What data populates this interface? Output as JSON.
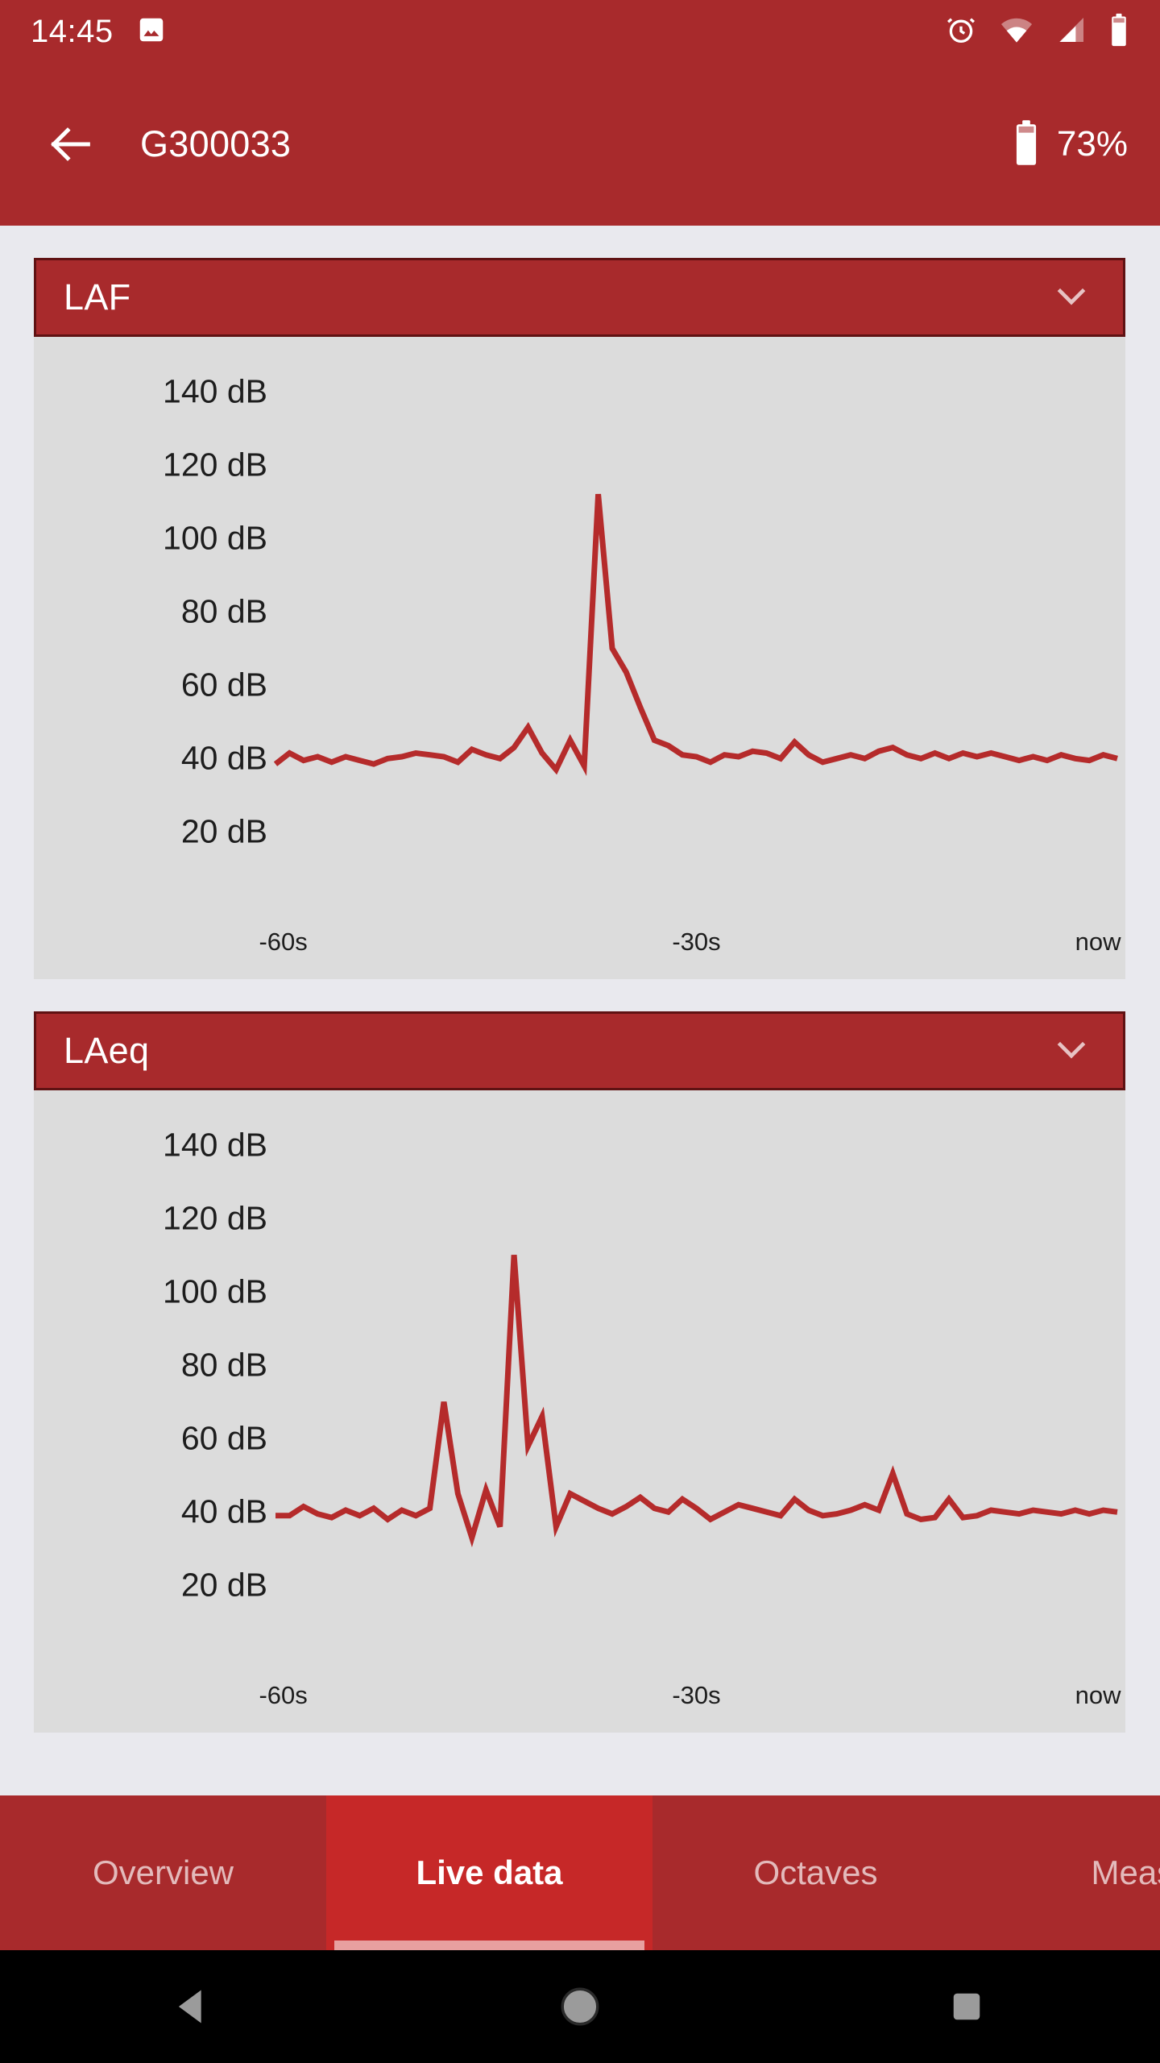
{
  "status_bar": {
    "time": "14:45",
    "icons": [
      "image-icon",
      "alarm-icon",
      "wifi-icon",
      "cell-signal-icon",
      "battery-icon"
    ],
    "bg_color": "#a82a2c"
  },
  "app_bar": {
    "back_label": "Back",
    "title": "G300033",
    "battery_percent": "73%",
    "bg_color": "#a82a2c"
  },
  "cards": [
    {
      "title": "LAF",
      "collapse_icon": "chevron-down-icon"
    },
    {
      "title": "LAeq",
      "collapse_icon": "chevron-down-icon"
    }
  ],
  "tabs": {
    "items": [
      {
        "label": "Overview",
        "active": false
      },
      {
        "label": "Live data",
        "active": true
      },
      {
        "label": "Octaves",
        "active": false
      },
      {
        "label": "Measu",
        "active": false
      }
    ]
  },
  "nav_bar": {
    "back": "back-triangle-icon",
    "home": "home-circle-icon",
    "recents": "recents-square-icon"
  },
  "colors": {
    "brand_red": "#a82a2c",
    "active_tab_red": "#c62828",
    "line_red": "#b52b2b",
    "page_bg": "#e9e9ee",
    "chart_bg": "#dcdcdc",
    "header_border": "#5f1213"
  },
  "chart_data": [
    {
      "type": "line",
      "title": "LAF",
      "xlabel": "",
      "ylabel": "dB",
      "ylim": [
        10,
        150
      ],
      "yticks": [
        140,
        120,
        100,
        80,
        60,
        40,
        20
      ],
      "ytick_labels": [
        "140 dB",
        "120 dB",
        "100 dB",
        "80 dB",
        "60 dB",
        "40 dB",
        "20 dB"
      ],
      "xlim": [
        -60,
        0
      ],
      "xticks": [
        -60,
        -30,
        0
      ],
      "xtick_labels": [
        "-60s",
        "-30s",
        "now"
      ],
      "grid": false,
      "legend": null,
      "series": [
        {
          "name": "LAF",
          "color": "#b52b2b",
          "x": [
            -60.0,
            -59.0,
            -58.0,
            -57.0,
            -56.0,
            -55.0,
            -54.0,
            -53.0,
            -52.0,
            -51.0,
            -50.0,
            -49.0,
            -48.0,
            -47.0,
            -46.0,
            -45.0,
            -44.0,
            -43.0,
            -42.0,
            -41.0,
            -40.0,
            -39.0,
            -38.0,
            -37.0,
            -36.0,
            -35.0,
            -34.0,
            -33.0,
            -32.0,
            -31.0,
            -30.0,
            -29.0,
            -28.0,
            -27.0,
            -26.0,
            -25.0,
            -24.0,
            -23.0,
            -22.0,
            -21.0,
            -20.0,
            -19.0,
            -18.0,
            -17.0,
            -16.0,
            -15.0,
            -14.0,
            -13.0,
            -12.0,
            -11.0,
            -10.0,
            -9.0,
            -8.0,
            -7.0,
            -6.0,
            -5.0,
            -4.0,
            -3.0,
            -2.0,
            -1.0,
            0.0
          ],
          "values": [
            38.5,
            41.5,
            39.5,
            40.5,
            39.0,
            40.5,
            39.5,
            38.5,
            40.0,
            40.5,
            41.5,
            41.0,
            40.5,
            39.0,
            42.5,
            41.0,
            40.0,
            43.0,
            48.5,
            41.5,
            37.0,
            45.0,
            38.0,
            112.0,
            70.0,
            63.5,
            54.0,
            45.0,
            43.5,
            41.0,
            40.5,
            39.0,
            41.0,
            40.5,
            42.0,
            41.5,
            40.0,
            44.5,
            41.0,
            39.0,
            40.0,
            41.0,
            40.0,
            42.0,
            43.0,
            41.0,
            40.0,
            41.5,
            40.0,
            41.5,
            40.5,
            41.5,
            40.5,
            39.5,
            40.5,
            39.5,
            41.0,
            40.0,
            39.5,
            41.0,
            40.0
          ]
        }
      ]
    },
    {
      "type": "line",
      "title": "LAeq",
      "xlabel": "",
      "ylabel": "dB",
      "ylim": [
        10,
        150
      ],
      "yticks": [
        140,
        120,
        100,
        80,
        60,
        40,
        20
      ],
      "ytick_labels": [
        "140 dB",
        "120 dB",
        "100 dB",
        "80 dB",
        "60 dB",
        "40 dB",
        "20 dB"
      ],
      "xlim": [
        -60,
        0
      ],
      "xticks": [
        -60,
        -30,
        0
      ],
      "xtick_labels": [
        "-60s",
        "-30s",
        "now"
      ],
      "grid": false,
      "legend": null,
      "series": [
        {
          "name": "LAeq",
          "color": "#b52b2b",
          "x": [
            -60.0,
            -59.0,
            -58.0,
            -57.0,
            -56.0,
            -55.0,
            -54.0,
            -53.0,
            -52.0,
            -51.0,
            -50.0,
            -49.0,
            -48.0,
            -47.0,
            -46.0,
            -45.0,
            -44.0,
            -43.0,
            -42.0,
            -41.0,
            -40.0,
            -39.0,
            -38.0,
            -37.0,
            -36.0,
            -35.0,
            -34.0,
            -33.0,
            -32.0,
            -31.0,
            -30.0,
            -29.0,
            -28.0,
            -27.0,
            -26.0,
            -25.0,
            -24.0,
            -23.0,
            -22.0,
            -21.0,
            -20.0,
            -19.0,
            -18.0,
            -17.0,
            -16.0,
            -15.0,
            -14.0,
            -13.0,
            -12.0,
            -11.0,
            -10.0,
            -9.0,
            -8.0,
            -7.0,
            -6.0,
            -5.0,
            -4.0,
            -3.0,
            -2.0,
            -1.0,
            0.0
          ],
          "values": [
            39.0,
            39.0,
            41.5,
            39.5,
            38.5,
            40.5,
            39.0,
            41.0,
            38.0,
            40.5,
            39.0,
            41.0,
            70.0,
            45.0,
            33.0,
            46.0,
            36.0,
            110.0,
            58.0,
            66.0,
            36.0,
            45.0,
            43.0,
            41.0,
            39.5,
            41.5,
            44.0,
            41.0,
            40.0,
            43.5,
            41.0,
            38.0,
            40.0,
            42.0,
            41.0,
            40.0,
            39.0,
            43.5,
            40.5,
            39.0,
            39.5,
            40.5,
            42.0,
            40.5,
            50.5,
            39.5,
            38.0,
            38.5,
            43.5,
            38.5,
            39.0,
            40.5,
            40.0,
            39.5,
            40.5,
            40.0,
            39.5,
            40.5,
            39.5,
            40.5,
            40.0
          ]
        }
      ]
    }
  ]
}
